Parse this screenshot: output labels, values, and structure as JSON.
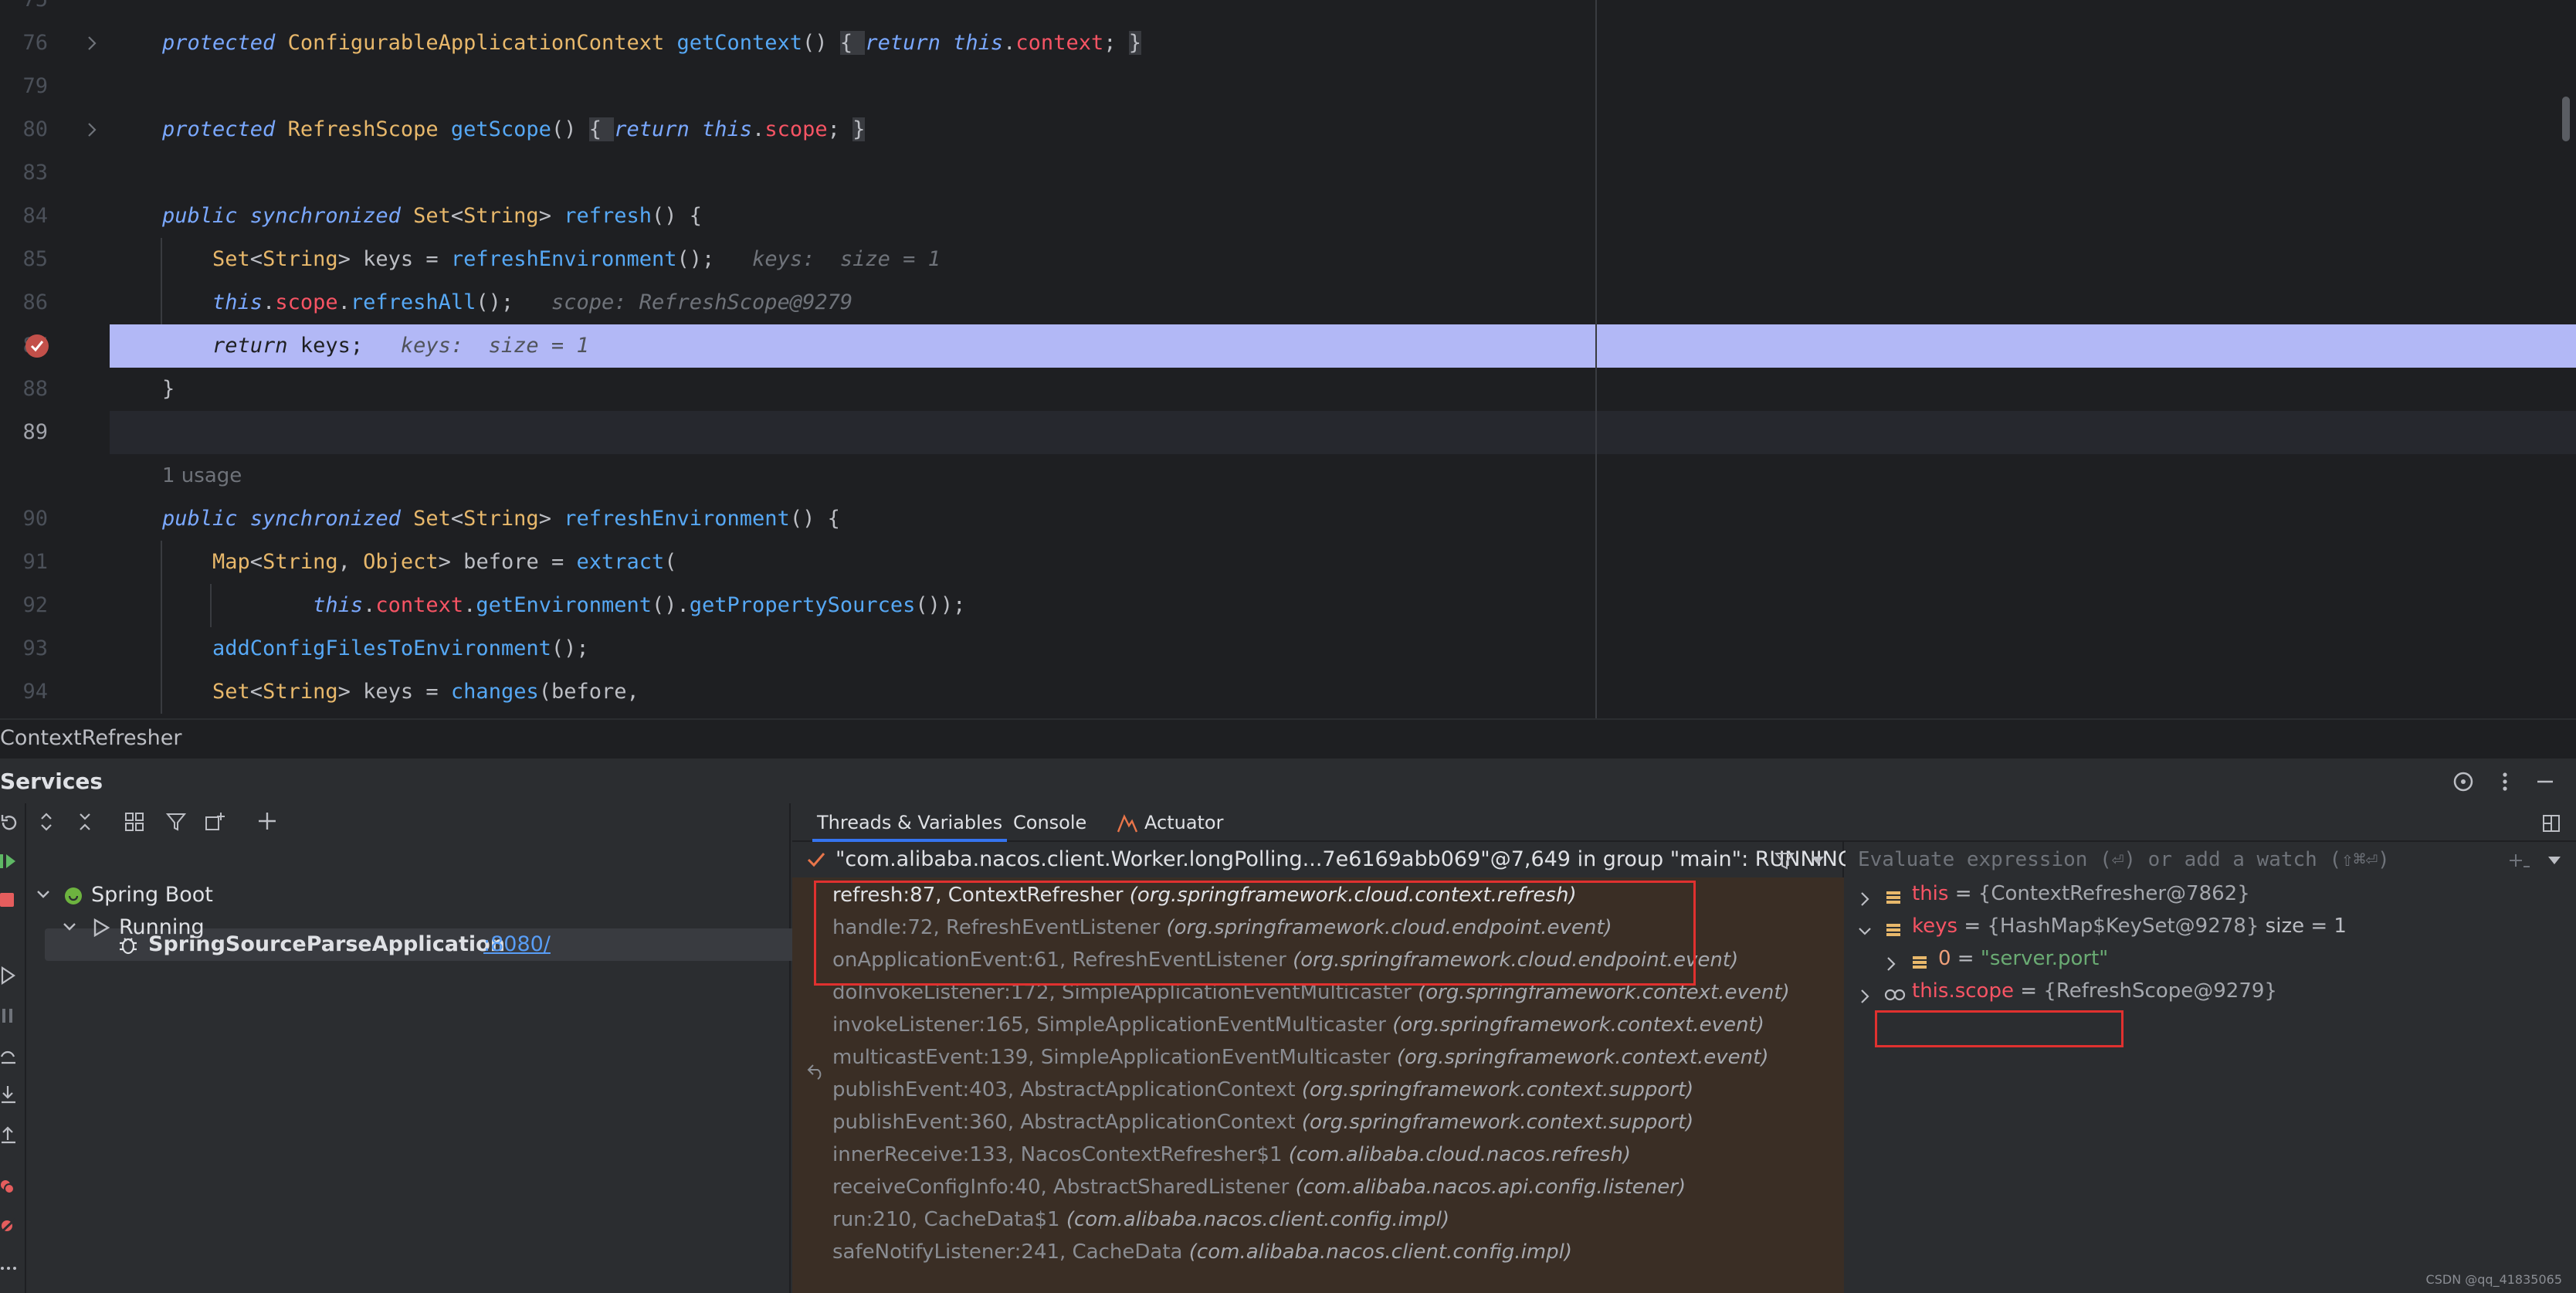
{
  "editor": {
    "lines": [
      {
        "num": "75",
        "tokens": []
      },
      {
        "num": "76",
        "tokens": [
          [
            "kw",
            "protected "
          ],
          [
            "ty",
            "ConfigurableApplicationContext "
          ],
          [
            "fn",
            "getContext"
          ],
          [
            "",
            "() "
          ],
          [
            "hl",
            "{ "
          ],
          [
            "kw",
            "return this"
          ],
          [
            "",
            "."
          ],
          [
            "fld",
            "context"
          ],
          [
            "",
            "; "
          ],
          [
            "hl",
            "}"
          ]
        ]
      },
      {
        "num": "79",
        "tokens": []
      },
      {
        "num": "80",
        "tokens": [
          [
            "kw",
            "protected "
          ],
          [
            "ty",
            "RefreshScope "
          ],
          [
            "fn",
            "getScope"
          ],
          [
            "",
            "() "
          ],
          [
            "hl",
            "{ "
          ],
          [
            "kw",
            "return this"
          ],
          [
            "",
            "."
          ],
          [
            "fld",
            "scope"
          ],
          [
            "",
            "; "
          ],
          [
            "hl",
            "}"
          ]
        ]
      },
      {
        "num": "83",
        "tokens": []
      },
      {
        "num": "84",
        "tokens": [
          [
            "kw",
            "public synchronized "
          ],
          [
            "ty",
            "Set"
          ],
          [
            "",
            "<"
          ],
          [
            "ty",
            "String"
          ],
          [
            "",
            "> "
          ],
          [
            "fn",
            "refresh"
          ],
          [
            "",
            "() {"
          ]
        ]
      },
      {
        "num": "85",
        "tokens": [
          [
            "ty",
            "    Set"
          ],
          [
            "",
            "<"
          ],
          [
            "ty",
            "String"
          ],
          [
            "",
            "> keys = "
          ],
          [
            "fn",
            "refreshEnvironment"
          ],
          [
            "",
            "();  "
          ],
          [
            "hint",
            " keys:  size = 1"
          ]
        ]
      },
      {
        "num": "86",
        "tokens": [
          [
            "kw",
            "    this"
          ],
          [
            "",
            "."
          ],
          [
            "fld",
            "scope"
          ],
          [
            "",
            "."
          ],
          [
            "fn",
            "refreshAll"
          ],
          [
            "",
            "();  "
          ],
          [
            "hint",
            " scope: RefreshScope@9279"
          ]
        ]
      },
      {
        "num": "87",
        "tokens": [
          [
            "dkw",
            "    return "
          ],
          [
            "dark",
            "keys;  "
          ],
          [
            "hint",
            " keys:  size = 1"
          ]
        ]
      },
      {
        "num": "88",
        "tokens": [
          [
            "",
            "}"
          ]
        ]
      },
      {
        "num": "89",
        "tokens": []
      },
      {
        "num": "",
        "tokens": [
          [
            "usage",
            "1 usage"
          ]
        ]
      },
      {
        "num": "90",
        "tokens": [
          [
            "kw",
            "public synchronized "
          ],
          [
            "ty",
            "Set"
          ],
          [
            "",
            "<"
          ],
          [
            "ty",
            "String"
          ],
          [
            "",
            "> "
          ],
          [
            "fn",
            "refreshEnvironment"
          ],
          [
            "",
            "() {"
          ]
        ]
      },
      {
        "num": "91",
        "tokens": [
          [
            "ty",
            "    Map"
          ],
          [
            "",
            "<"
          ],
          [
            "ty",
            "String"
          ],
          [
            ",",
            ", "
          ],
          [
            "ty",
            "Object"
          ],
          [
            "",
            "> before = "
          ],
          [
            "fn",
            "extract"
          ],
          [
            "",
            "("
          ]
        ]
      },
      {
        "num": "92",
        "tokens": [
          [
            "kw",
            "            this"
          ],
          [
            "",
            "."
          ],
          [
            "fld",
            "context"
          ],
          [
            "",
            "."
          ],
          [
            "fn",
            "getEnvironment"
          ],
          [
            "",
            "()."
          ],
          [
            "fn",
            "getPropertySources"
          ],
          [
            "",
            "());"
          ]
        ]
      },
      {
        "num": "93",
        "tokens": [
          [
            "fn",
            "    addConfigFilesToEnvironment"
          ],
          [
            "",
            "();"
          ]
        ]
      },
      {
        "num": "94",
        "tokens": [
          [
            "ty",
            "    Set"
          ],
          [
            "",
            "<"
          ],
          [
            "ty",
            "String"
          ],
          [
            "",
            "> keys = "
          ],
          [
            "fn",
            "changes"
          ],
          [
            "",
            "(before,"
          ]
        ]
      }
    ]
  },
  "breadcrumb": "ContextRefresher",
  "services": {
    "title": "Services",
    "tree": {
      "root": "Spring Boot",
      "group": "Running",
      "app_name": "SpringSourceParseApplication",
      "app_port": ":8080/"
    }
  },
  "debugger": {
    "tabs": [
      "Threads & Variables",
      "Console",
      "Actuator"
    ],
    "thread": "\"com.alibaba.nacos.client.Worker.longPolling...7e6169abb069\"@7,649 in group \"main\": RUNNING",
    "frames": [
      {
        "method": "refresh:87, ContextRefresher ",
        "pkg": "(org.springframework.cloud.context.refresh)"
      },
      {
        "method": "handle:72, RefreshEventListener ",
        "pkg": "(org.springframework.cloud.endpoint.event)"
      },
      {
        "method": "onApplicationEvent:61, RefreshEventListener ",
        "pkg": "(org.springframework.cloud.endpoint.event)"
      },
      {
        "method": "doInvokeListener:172, SimpleApplicationEventMulticaster ",
        "pkg": "(org.springframework.context.event)"
      },
      {
        "method": "invokeListener:165, SimpleApplicationEventMulticaster ",
        "pkg": "(org.springframework.context.event)"
      },
      {
        "method": "multicastEvent:139, SimpleApplicationEventMulticaster ",
        "pkg": "(org.springframework.context.event)"
      },
      {
        "method": "publishEvent:403, AbstractApplicationContext ",
        "pkg": "(org.springframework.context.support)"
      },
      {
        "method": "publishEvent:360, AbstractApplicationContext ",
        "pkg": "(org.springframework.context.support)"
      },
      {
        "method": "innerReceive:133, NacosContextRefresher$1 ",
        "pkg": "(com.alibaba.cloud.nacos.refresh)"
      },
      {
        "method": "receiveConfigInfo:40, AbstractSharedListener ",
        "pkg": "(com.alibaba.nacos.api.config.listener)"
      },
      {
        "method": "run:210, CacheData$1 ",
        "pkg": "(com.alibaba.nacos.client.config.impl)"
      },
      {
        "method": "safeNotifyListener:241, CacheData ",
        "pkg": "(com.alibaba.nacos.client.config.impl)"
      }
    ],
    "eval_placeholder": "Evaluate expression (⏎) or add a watch (⇧⌘⏎)",
    "variables": [
      {
        "name": "this",
        "eq": " = ",
        "value": "{ContextRefresher@7862}",
        "extra": ""
      },
      {
        "name": "keys",
        "eq": " = ",
        "value": "{HashMap$KeySet@9278}",
        "extra": "  size = 1"
      },
      {
        "name": "0",
        "eq": " = ",
        "value": "\"server.port\"",
        "extra": ""
      },
      {
        "name": "this.scope",
        "eq": " = ",
        "value": "{RefreshScope@9279}",
        "extra": ""
      }
    ]
  },
  "watermark": "CSDN @qq_41835065",
  "colors": {
    "accent": "#3574f0",
    "exec_line": "#b2b8f6",
    "highlight_box": "#e0312f",
    "frames_bg": "#3a2e25"
  }
}
